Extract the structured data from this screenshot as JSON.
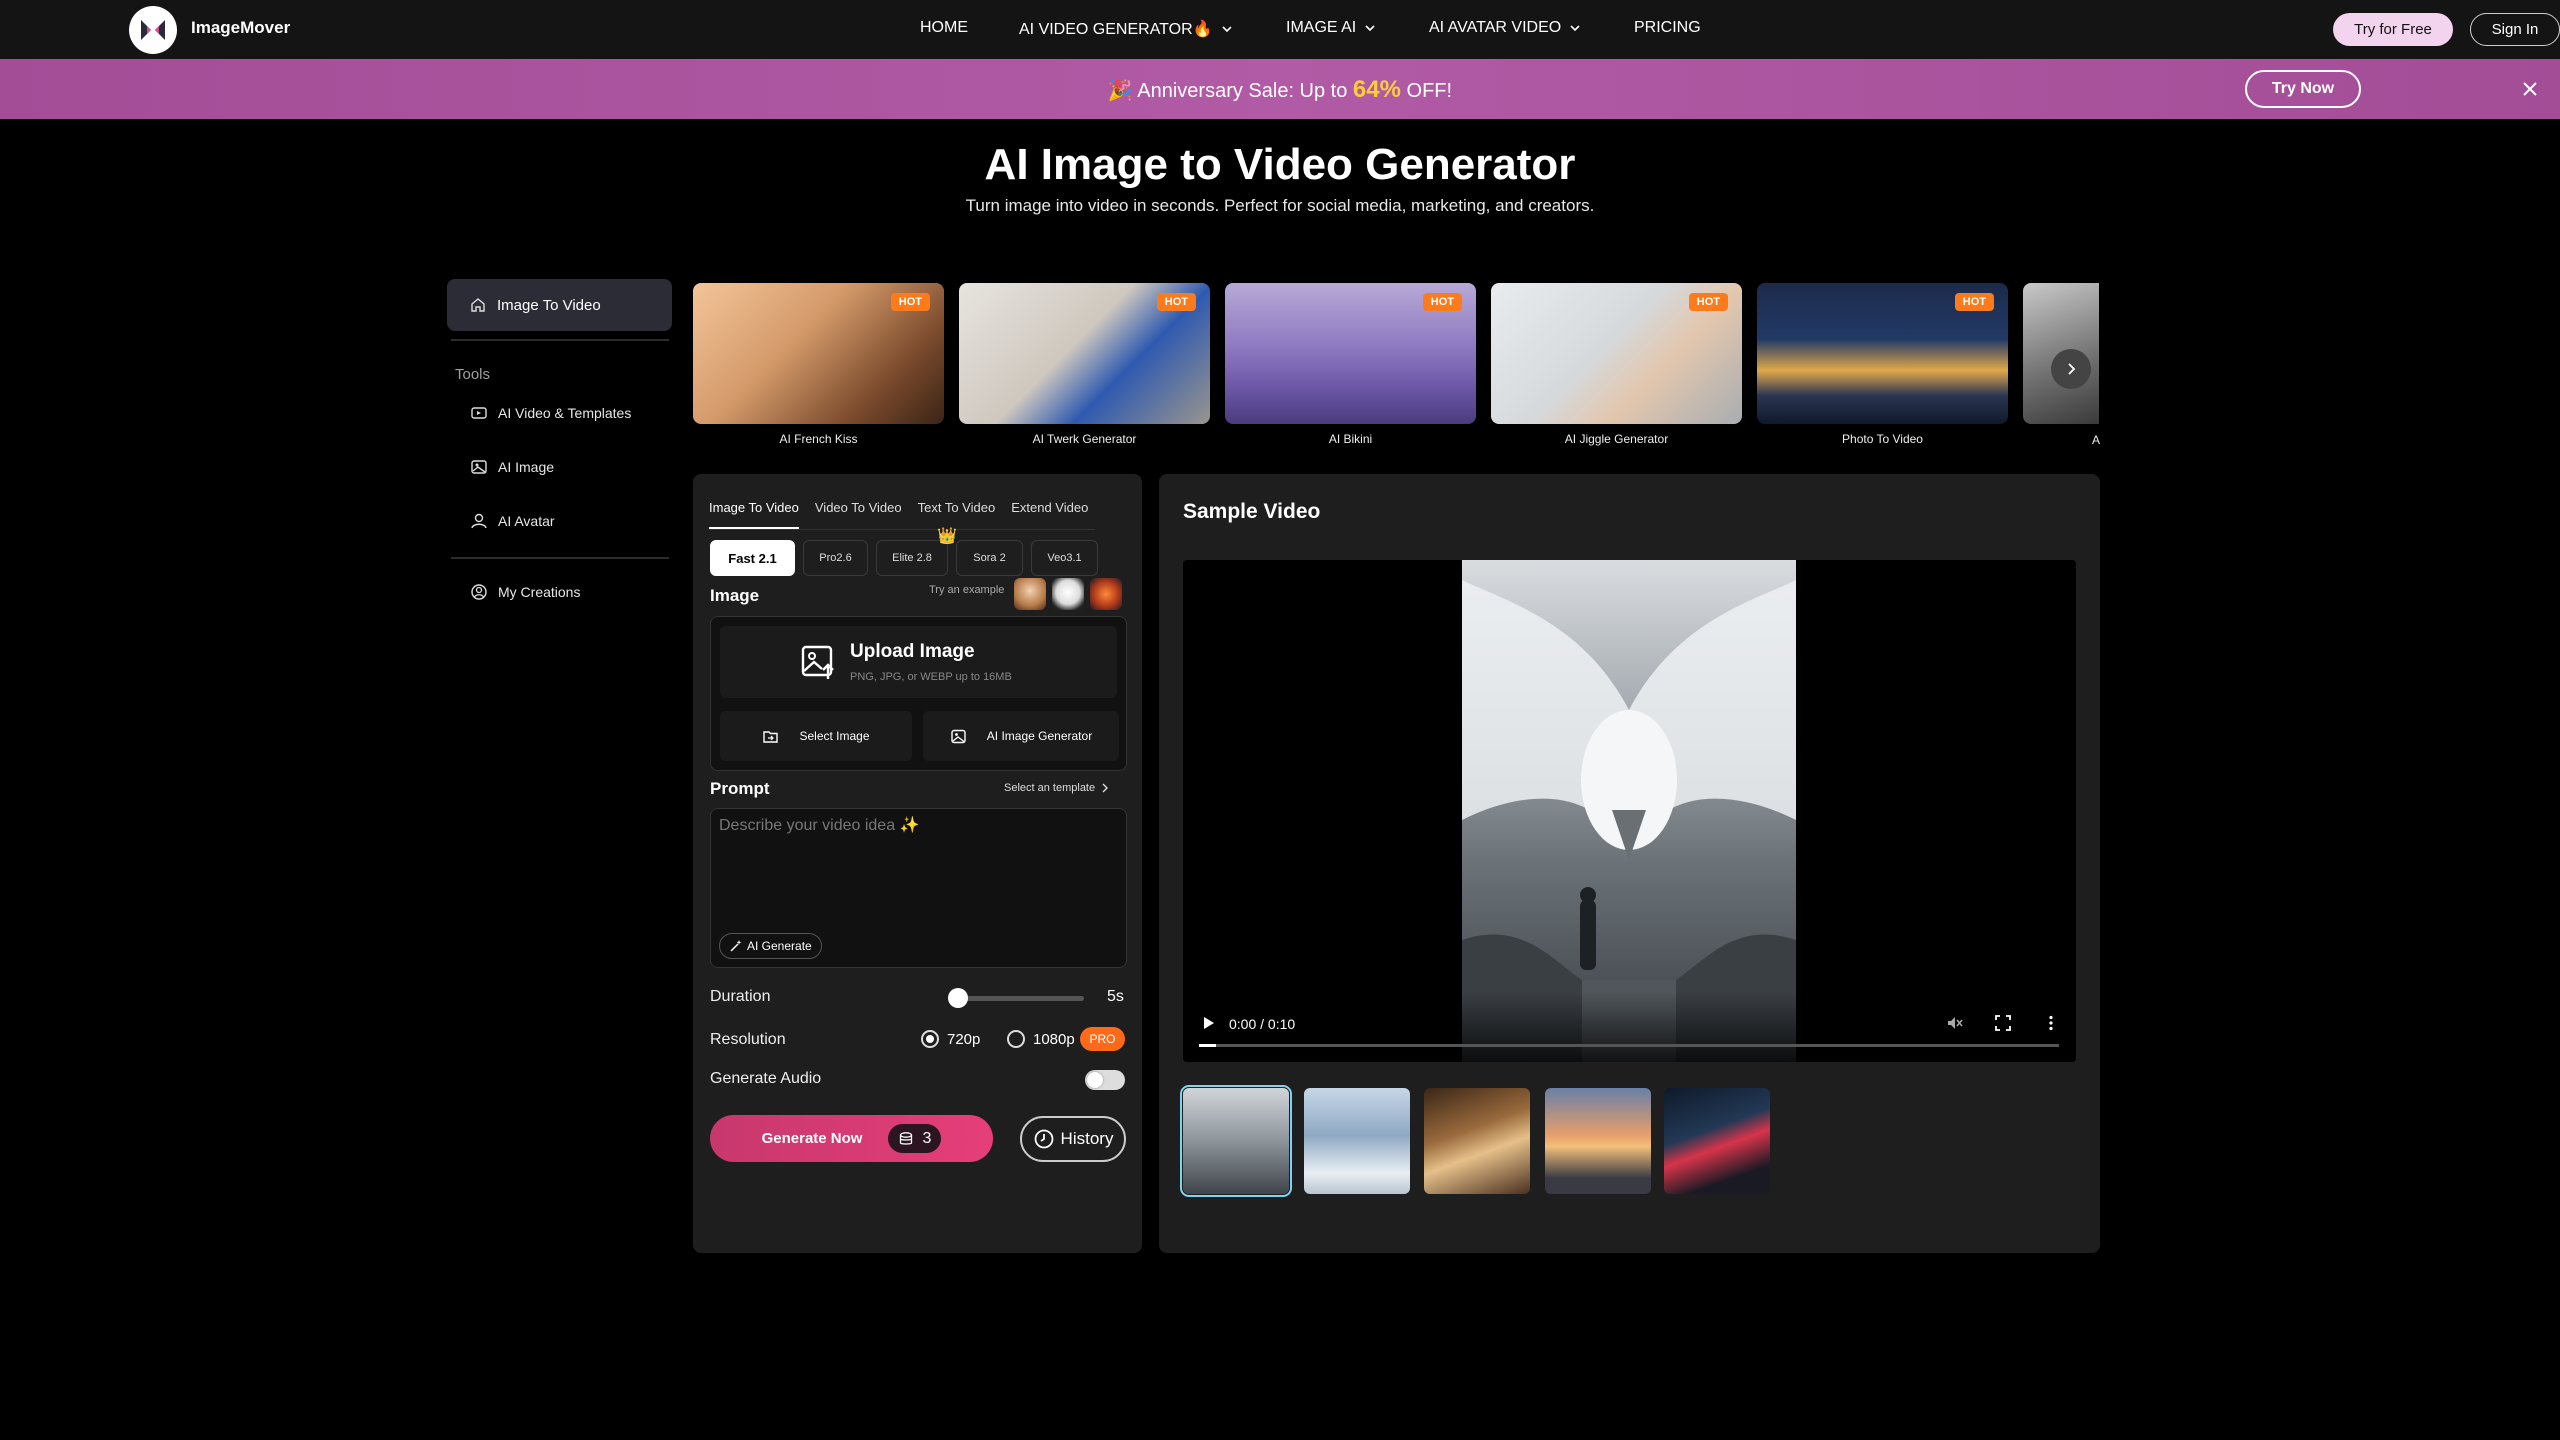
{
  "brand": {
    "name": "ImageMover"
  },
  "nav": {
    "items": [
      {
        "label": "HOME",
        "has_dropdown": false
      },
      {
        "label": "AI VIDEO GENERATOR🔥",
        "has_dropdown": true
      },
      {
        "label": "IMAGE AI",
        "has_dropdown": true
      },
      {
        "label": "AI AVATAR VIDEO",
        "has_dropdown": true
      },
      {
        "label": "PRICING",
        "has_dropdown": false
      }
    ],
    "try_free": "Try for Free",
    "sign_in": "Sign In"
  },
  "promo": {
    "prefix": "🎉 Anniversary Sale: Up to ",
    "percent": "64%",
    "suffix": " OFF!",
    "button": "Try Now"
  },
  "hero": {
    "title": "AI Image to Video Generator",
    "subtitle": "Turn image into video in seconds. Perfect for social media, marketing, and creators."
  },
  "sidebar": {
    "active_item": "Image To Video",
    "tools_heading": "Tools",
    "items": [
      "AI Video & Templates",
      "AI Image",
      "AI Avatar"
    ],
    "my_creations": "My Creations"
  },
  "templates": {
    "cards": [
      {
        "label": "AI French Kiss",
        "badge": "HOT"
      },
      {
        "label": "AI Twerk Generator",
        "badge": "HOT"
      },
      {
        "label": "AI Bikini",
        "badge": "HOT"
      },
      {
        "label": "AI Jiggle Generator",
        "badge": "HOT"
      },
      {
        "label": "Photo To Video",
        "badge": "HOT"
      }
    ],
    "partial_label": "A"
  },
  "generator": {
    "tabs": [
      "Image To Video",
      "Video To Video",
      "Text To Video",
      "Extend Video"
    ],
    "active_tab": 0,
    "models": [
      "Fast 2.1",
      "Pro2.6",
      "Elite 2.8",
      "Sora 2",
      "Veo3.1"
    ],
    "active_model": 0,
    "image_label": "Image",
    "try_example": "Try an example",
    "upload_title": "Upload Image",
    "upload_sub": "PNG, JPG, or WEBP up to 16MB",
    "select_image": "Select Image",
    "ai_image_generator": "AI Image Generator",
    "prompt_label": "Prompt",
    "select_template": "Select an template",
    "prompt_placeholder": "Describe your video idea ✨",
    "prompt_value": "",
    "ai_generate": "AI Generate",
    "duration_label": "Duration",
    "duration_value": "5s",
    "duration_fraction": 0.0,
    "resolution_label": "Resolution",
    "resolutions": [
      "720p",
      "1080p"
    ],
    "selected_resolution": "720p",
    "pro_badge": "PRO",
    "audio_label": "Generate Audio",
    "audio_on": false,
    "generate_button": "Generate Now",
    "credits": "3",
    "history_button": "History"
  },
  "sample": {
    "title": "Sample Video",
    "time": "0:00 / 0:10",
    "progress_fraction": 0.02,
    "active_thumb": 0
  },
  "colors": {
    "accent_pink": "#e63e79",
    "promo_purple": "#a34d97",
    "promo_highlight": "#ffcd3c",
    "hot_badge": "#ff7a1a",
    "thumb_outline": "#7fd3f2"
  }
}
